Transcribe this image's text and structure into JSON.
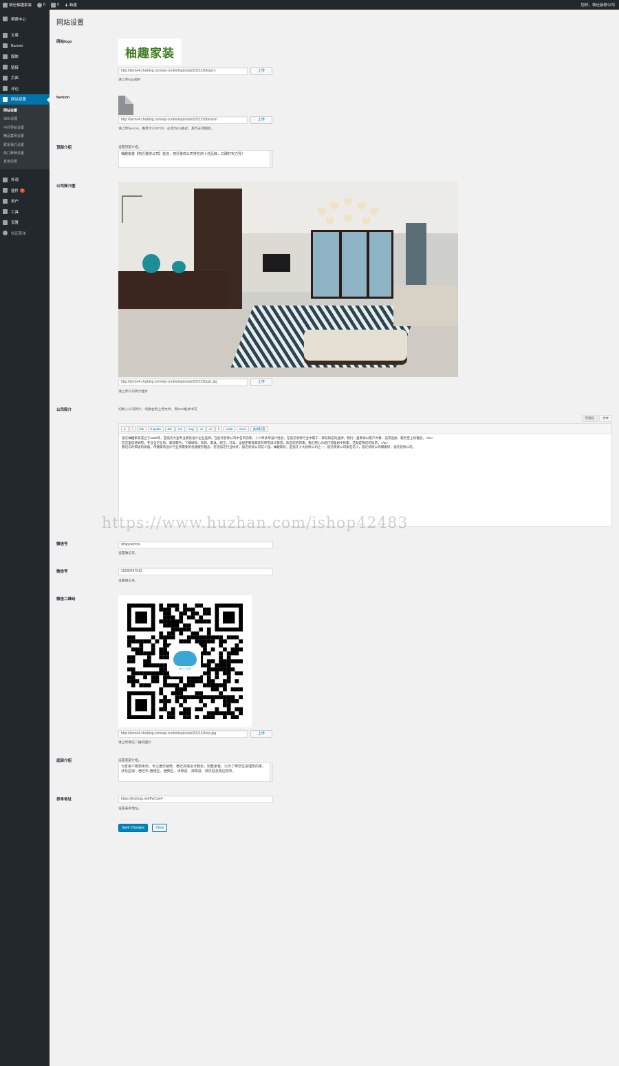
{
  "adminbar": {
    "site_name": "宿迁柚趣家装",
    "updates_count": "6",
    "comments_count": "0",
    "new_label": "新建",
    "howdy": "您好，宿迁装修公司"
  },
  "sidebar": {
    "dashboard": "帮帮中心",
    "posts": "文章",
    "banner": "Banner",
    "media": "媒体",
    "links": "链接",
    "pages": "页面",
    "comments": "评论",
    "site_settings": "网站设置",
    "submenu": [
      "网站设置",
      "SEO设置",
      "中间导航设置",
      "精品案例设置",
      "联系我们设置",
      "热门推荐设置",
      "其他设置"
    ],
    "appearance": "外观",
    "plugins": "插件",
    "plugins_badge": "2",
    "users": "用户",
    "tools": "工具",
    "settings": "设置",
    "collapse": "收起菜单"
  },
  "page": {
    "title": "网站设置",
    "logo_label": "网站logo",
    "logo_text": "柚趣家装",
    "logo_url": "http://demo4.chwblog.com/wp-content/uploads/2021/03/logo-1",
    "upload_label": "上传",
    "logo_desc": "请上传logo图片",
    "favicon_label": "favicon",
    "favicon_url": "http://demo4.chwblog.com/wp-content/uploads/2021/03/favicon",
    "favicon_desc": "请上传favicon。推荐大小32*32，必须为ico格式。其不支持图标。",
    "header_label": "顶部介绍",
    "header_desc": "设置顶部介绍。",
    "header_text": "柚趣家装【宿迁装修公司】首选，宿迁装修公司排名前十佳品牌，口碑好实力强！",
    "company_image_label": "公司简介图",
    "company_image_url": "http://demo4.chwblog.com/wp-content/uploads/2021/03/gs1.jpg",
    "company_image_desc": "请上传公司简介图片",
    "company_intro_label": "公司简介",
    "company_intro_desc": "切换入公司简介，切换右侧上传文件，用html格式书写",
    "tab_visual": "可视化",
    "tab_text": "文本",
    "toolbar": [
      "b",
      "i",
      "link",
      "b-quote",
      "del",
      "ins",
      "img",
      "ul",
      "ol",
      "li",
      "code",
      "more",
      "关闭标签"
    ],
    "intro_content": "宿迁柚趣家装成立于2019年，是宿迁大型专业家装设计企业品牌，在宿迁装修公司中名列前茅，十六年多年设计经验，在宿迁装修行业中属于一家较知名的品牌，我们一直秉承以客户为尊、追求品质、服务至上的理念。</br>\n在这里您将拥有，专业全方位的，家装服务，了解硬装、软装、家具、厨卫、灯具、全屋定制等家装的所有设计需求，欢迎您的到来，我们用心为您打造理想中的家，这就是我们的追求，</br>\n我们与时俱进的发展，传播家装设计行业所需要的优质服务理念，打造宿迁行业标杆，宿迁装修公司前十强，柚趣家装，是宿迁十大装修公司之一，宿迁装修公司排名前十，宿迁装修公司哪家好，宿迁装修公司。",
    "wechat_label": "微信号",
    "wechat_value": "qingyueyeyu",
    "wechat_desc": "设置微信号。",
    "phone_label": "微信号",
    "phone_value": "15290467512",
    "phone_desc": "设置微信号。",
    "qr_label": "微信二维码",
    "qr_logo_text": "豪云工作室",
    "qr_url": "http://demo4.chwblog.com/wp-content/uploads/2021/03/wx.jpg",
    "qr_desc": "请上传微信二维码图片",
    "footer_label": "底部介绍",
    "footer_desc": "设置底部介绍。",
    "footer_text": "为爱家户着想考虑，专注宿迁装修、宿迁高端设计服务，别墅家装，只为了带您住进理想的家。\n涉及区域：宿迁市-宿城区、宿豫区、沭阳县、泗阳县、泗洪县及周边地市。",
    "form_label": "表单地址",
    "form_value": "https://jinshuju.net/f/wCart4",
    "form_desc": "设置表单地址。",
    "save_label": "Save Changes",
    "clear_label": "Clear"
  },
  "watermark": "https://www.huzhan.com/ishop42483"
}
